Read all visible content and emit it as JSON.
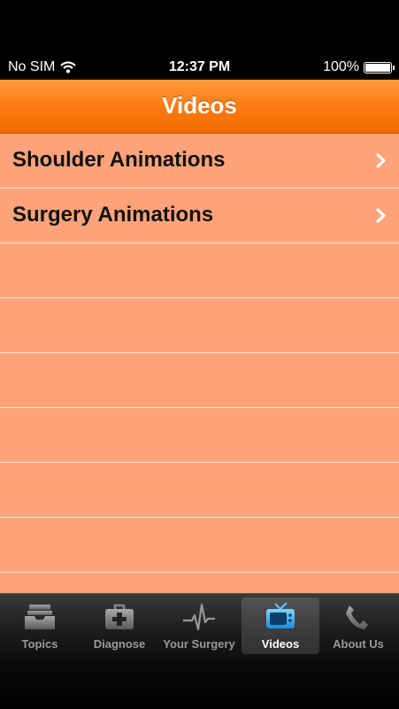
{
  "status": {
    "carrier": "No SIM",
    "time": "12:37 PM",
    "battery": "100%"
  },
  "nav": {
    "title": "Videos"
  },
  "list": {
    "rows": [
      {
        "label": "Shoulder Animations"
      },
      {
        "label": "Surgery Animations"
      },
      {
        "label": ""
      },
      {
        "label": ""
      },
      {
        "label": ""
      },
      {
        "label": ""
      },
      {
        "label": ""
      },
      {
        "label": ""
      },
      {
        "label": ""
      }
    ]
  },
  "tabs": [
    {
      "label": "Topics",
      "icon": "inbox-tray-icon"
    },
    {
      "label": "Diagnose",
      "icon": "medical-kit-icon"
    },
    {
      "label": "Your Surgery",
      "icon": "heartbeat-icon"
    },
    {
      "label": "Videos",
      "icon": "tv-icon",
      "active": true
    },
    {
      "label": "About Us",
      "icon": "phone-icon"
    }
  ],
  "colors": {
    "nav": "#fc7e14",
    "list_bg": "#ffa37a",
    "active_icon": "#2aa8ff"
  }
}
